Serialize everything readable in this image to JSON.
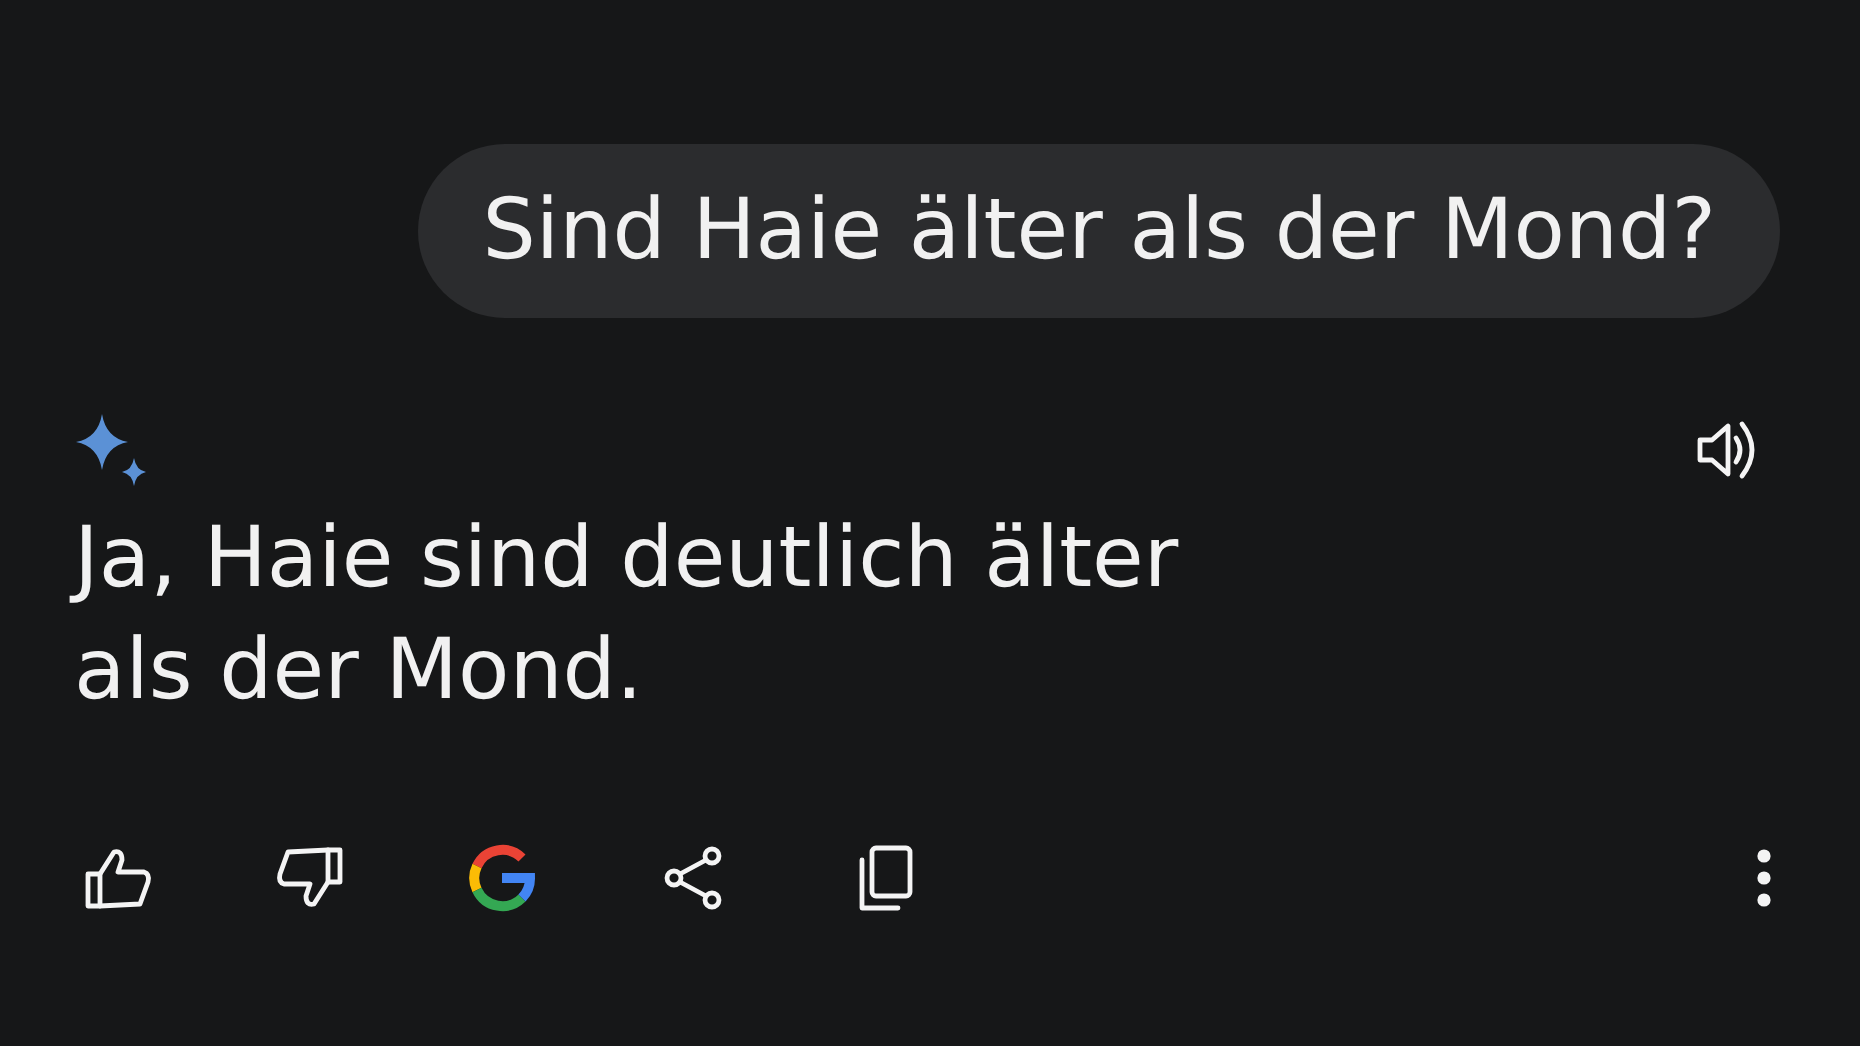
{
  "user_message": {
    "text": "Sind Haie älter als der Mond?"
  },
  "response": {
    "text": "Ja, Haie sind deutlich älter als der Mond."
  },
  "actions": [
    {
      "kind": "thumbs_up"
    },
    {
      "kind": "thumbs_down"
    },
    {
      "kind": "google"
    },
    {
      "kind": "share"
    },
    {
      "kind": "copy"
    }
  ]
}
